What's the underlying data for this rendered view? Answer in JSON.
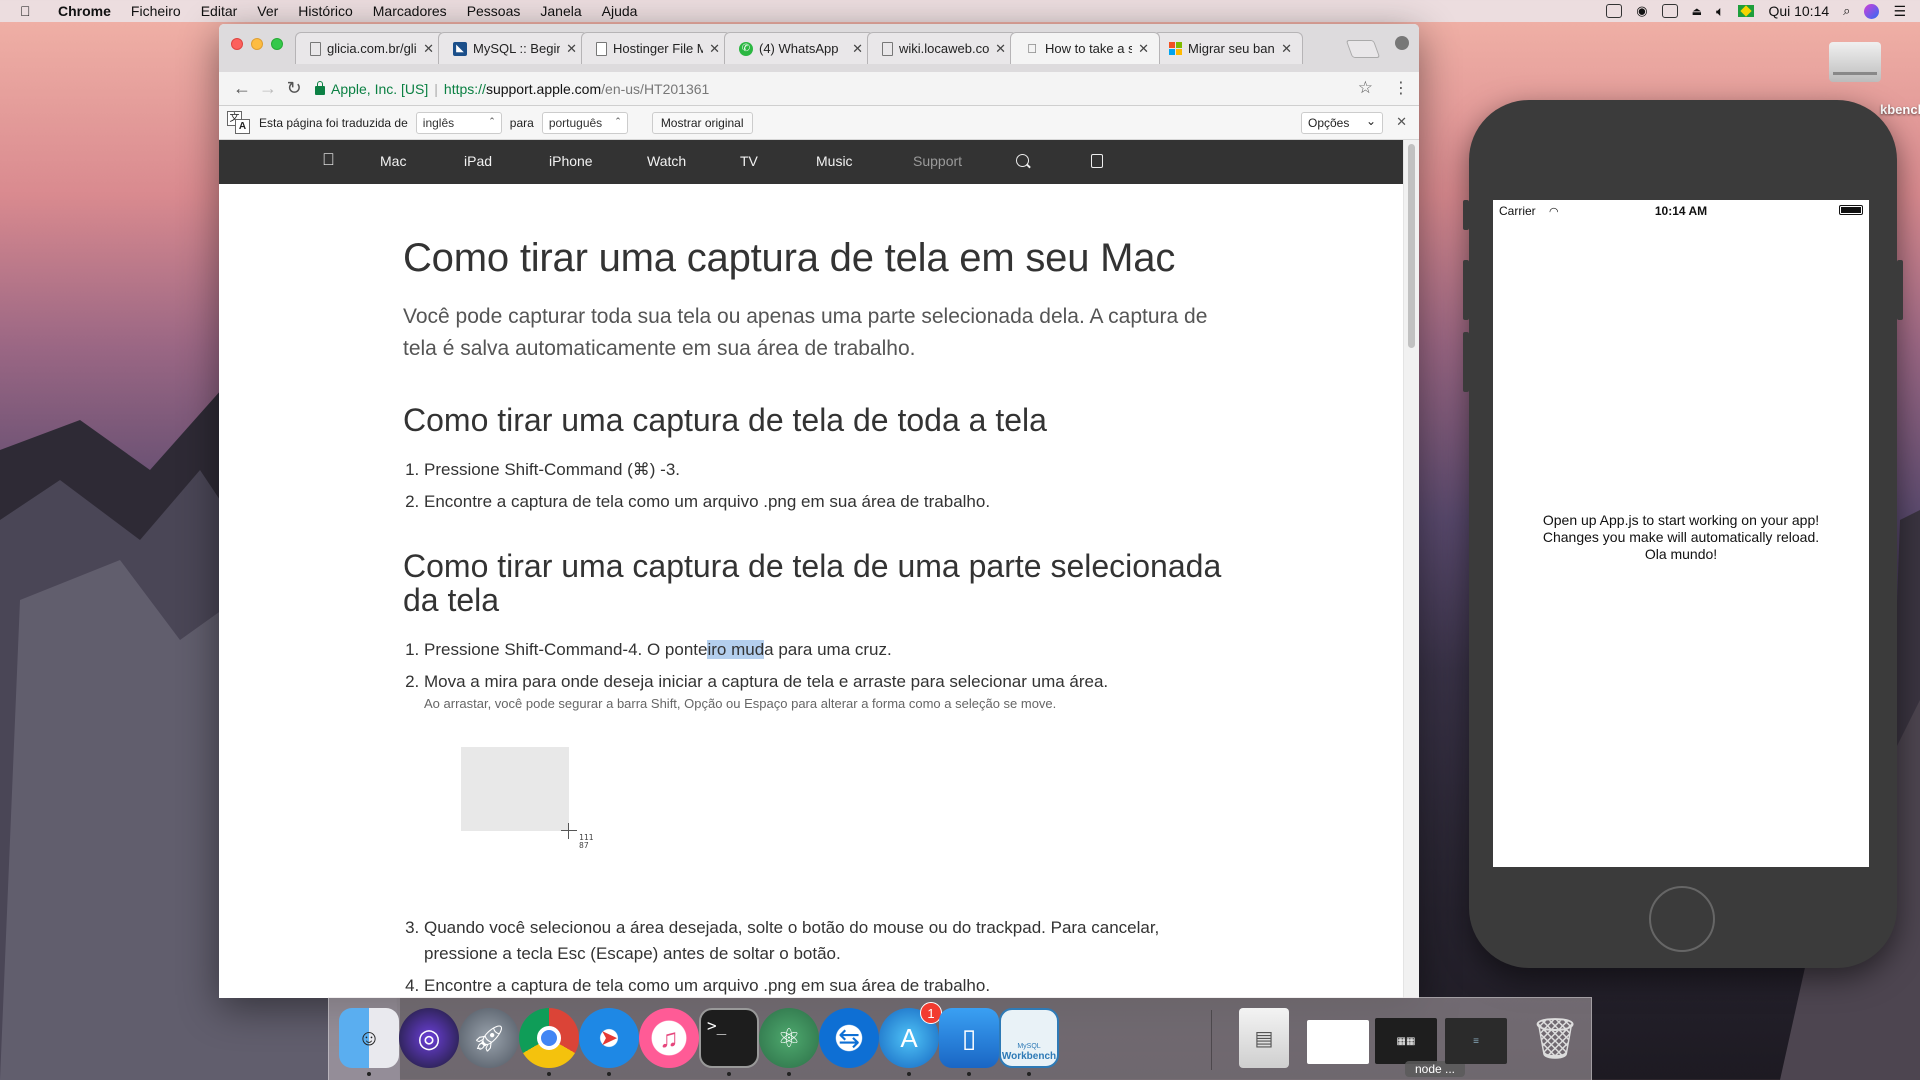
{
  "menubar": {
    "app_name": "Chrome",
    "items": [
      "Ficheiro",
      "Editar",
      "Ver",
      "Histórico",
      "Marcadores",
      "Pessoas",
      "Janela",
      "Ajuda"
    ],
    "clock": "Qui 10:14"
  },
  "browser": {
    "tabs": [
      {
        "title": "glicia.com.br/glic",
        "favicon": "document-icon"
      },
      {
        "title": "MySQL :: Begin Y",
        "favicon": "mysql-icon"
      },
      {
        "title": "Hostinger File Ma",
        "favicon": "document-icon"
      },
      {
        "title": "(4) WhatsApp",
        "favicon": "whatsapp-icon"
      },
      {
        "title": "wiki.locaweb.com",
        "favicon": "document-icon"
      },
      {
        "title": "How to take a sc",
        "favicon": "apple-icon",
        "active": true
      },
      {
        "title": "Migrar seu banco",
        "favicon": "microsoft-icon"
      }
    ],
    "address": {
      "ev_name": "Apple, Inc. [US]",
      "scheme": "https://",
      "host": "support.apple.com",
      "path": "/en-us/HT201361"
    },
    "translate_bar": {
      "prefix": "Esta página foi traduzida de",
      "from_lang": "inglês",
      "to_label": "para",
      "to_lang": "português",
      "show_original": "Mostrar original",
      "options": "Opções"
    }
  },
  "apple_nav": {
    "items": [
      "Mac",
      "iPad",
      "iPhone",
      "Watch",
      "TV",
      "Music",
      "Support"
    ]
  },
  "article": {
    "title": "Como tirar uma captura de tela em seu Mac",
    "intro": "Você pode capturar toda sua tela ou apenas uma parte selecionada dela. A captura de tela é salva automaticamente em sua área de trabalho.",
    "section1": {
      "heading": "Como tirar uma captura de tela de toda a tela",
      "steps": [
        "Pressione Shift-Command (⌘) -3.",
        "Encontre a captura de tela como um arquivo .png em sua área de trabalho."
      ]
    },
    "section2": {
      "heading": "Como tirar uma captura de tela de uma parte selecionada da tela",
      "step1_before": "Pressione Shift-Command-4. O ponte",
      "step1_highlight": "iro mud",
      "step1_after": "a para uma cruz.",
      "step2": "Mova a mira para onde deseja iniciar a captura de tela e arraste para selecionar uma área.",
      "step2_note": "Ao arrastar, você pode segurar a barra Shift, Opção ou Espaço para alterar a forma como a seleção se move.",
      "demo_w": "111",
      "demo_h": "87",
      "step3": "Quando você selecionou a área desejada, solte o botão do mouse ou do trackpad. Para cancelar, pressione a tecla Esc (Escape) antes de soltar o botão.",
      "step4": "Encontre a captura de tela como um arquivo .png em sua área de trabalho."
    }
  },
  "simulator": {
    "carrier": "Carrier",
    "time": "10:14 AM",
    "lines": [
      "Open up App.js to start working on your app!",
      "Changes you make will automatically reload.",
      "Ola mundo!"
    ]
  },
  "desktop": {
    "workbench_label": "kbench"
  },
  "dock": {
    "app_store_badge": "1",
    "mysql_label_small": "MySQL",
    "mysql_label": "Workbench",
    "node_label": "node ..."
  }
}
